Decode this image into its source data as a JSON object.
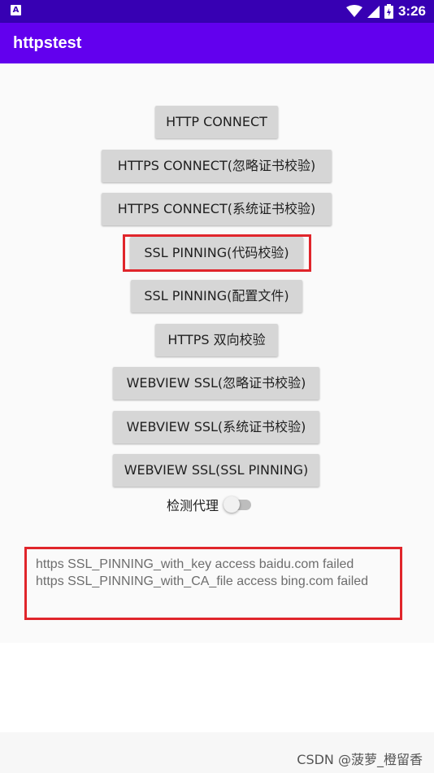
{
  "status_bar": {
    "time": "3:26",
    "app_icon": "A"
  },
  "app_bar": {
    "title": "httpstest"
  },
  "buttons": {
    "http_connect": "HTTP CONNECT",
    "https_ignore": "HTTPS CONNECT(忽略证书校验)",
    "https_system": "HTTPS CONNECT(系统证书校验)",
    "ssl_pinning_code": "SSL PINNING(代码校验)",
    "ssl_pinning_config": "SSL PINNING(配置文件)",
    "https_mutual": "HTTPS 双向校验",
    "webview_ignore": "WEBVIEW SSL(忽略证书校验)",
    "webview_system": "WEBVIEW SSL(系统证书校验)",
    "webview_pinning": "WEBVIEW SSL(SSL PINNING)"
  },
  "proxy_toggle": {
    "label": "检测代理",
    "checked": false
  },
  "result": {
    "line1": "https SSL_PINNING_with_key access baidu.com failed",
    "line2": "https SSL_PINNING_with_CA_file access bing.com failed"
  },
  "watermark": "CSDN @菠萝_橙留香",
  "colors": {
    "status_bar": "#3700b3",
    "app_bar": "#6200ee",
    "highlight": "#e0252b",
    "button": "#d6d6d6"
  },
  "icons": {
    "status": [
      "wifi-icon",
      "signal-icon",
      "battery-icon"
    ]
  }
}
